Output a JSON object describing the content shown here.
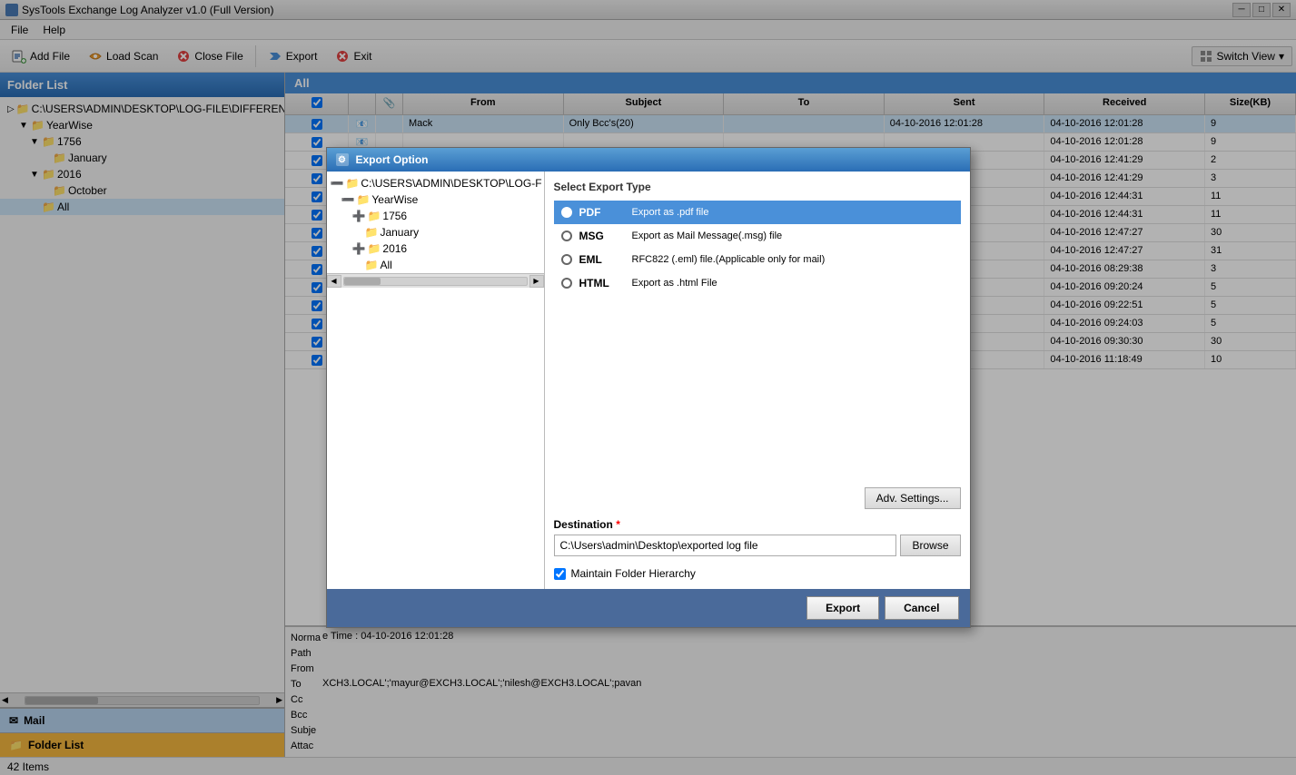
{
  "app": {
    "title": "SysTools Exchange Log Analyzer v1.0 (Full Version)"
  },
  "menu": {
    "items": [
      "File",
      "Help"
    ]
  },
  "toolbar": {
    "buttons": [
      {
        "id": "add-file",
        "label": "Add File",
        "icon": "➕"
      },
      {
        "id": "load-scan",
        "label": "Load Scan",
        "icon": "📂"
      },
      {
        "id": "close-file",
        "label": "Close File",
        "icon": "✖"
      },
      {
        "id": "export",
        "label": "Export",
        "icon": "▶"
      },
      {
        "id": "exit",
        "label": "Exit",
        "icon": "✖"
      }
    ],
    "switch_view": "Switch View"
  },
  "folder_list": {
    "header": "Folder List",
    "tree": [
      {
        "id": "root",
        "label": "C:\\USERS\\ADMIN\\DESKTOP\\LOG-FILE\\DIFFERENTT",
        "indent": 0,
        "icon": "folder",
        "expanded": true
      },
      {
        "id": "yearwise",
        "label": "YearWise",
        "indent": 1,
        "icon": "folder",
        "expanded": true
      },
      {
        "id": "1756",
        "label": "1756",
        "indent": 2,
        "icon": "folder",
        "expanded": true
      },
      {
        "id": "january",
        "label": "January",
        "indent": 3,
        "icon": "folder",
        "expanded": false
      },
      {
        "id": "2016",
        "label": "2016",
        "indent": 2,
        "icon": "folder",
        "expanded": true
      },
      {
        "id": "october",
        "label": "October",
        "indent": 3,
        "icon": "folder",
        "expanded": false
      },
      {
        "id": "all",
        "label": "All",
        "indent": 2,
        "icon": "folder",
        "expanded": false,
        "selected": true
      }
    ],
    "bottom_tabs": [
      {
        "id": "mail",
        "label": "Mail"
      },
      {
        "id": "folder-list",
        "label": "Folder List"
      }
    ]
  },
  "main_panel": {
    "header": "All",
    "columns": [
      "",
      "",
      "",
      "From",
      "Subject",
      "To",
      "Sent",
      "Received",
      "Size(KB)"
    ],
    "rows": [
      {
        "checked": true,
        "from": "Mack",
        "subject": "Only Bcc's(20)",
        "to": "",
        "sent": "04-10-2016 12:01:28",
        "received": "04-10-2016 12:01:28",
        "size": "9",
        "selected": true
      },
      {
        "checked": true,
        "from": "",
        "subject": "",
        "to": "",
        "sent": "",
        "received": "04-10-2016 12:01:28",
        "size": "9"
      },
      {
        "checked": true,
        "from": "",
        "subject": "",
        "to": "",
        "sent": "",
        "received": "04-10-2016 12:41:29",
        "size": "2"
      },
      {
        "checked": true,
        "from": "",
        "subject": "",
        "to": "",
        "sent": "",
        "received": "04-10-2016 12:41:29",
        "size": "3"
      },
      {
        "checked": true,
        "from": "",
        "subject": "",
        "to": "",
        "sent": "",
        "received": "04-10-2016 12:44:31",
        "size": "11"
      },
      {
        "checked": true,
        "from": "",
        "subject": "",
        "to": "",
        "sent": "",
        "received": "04-10-2016 12:44:31",
        "size": "11"
      },
      {
        "checked": true,
        "from": "",
        "subject": "",
        "to": "",
        "sent": "",
        "received": "04-10-2016 12:47:27",
        "size": "30"
      },
      {
        "checked": true,
        "from": "",
        "subject": "",
        "to": "",
        "sent": "",
        "received": "04-10-2016 12:47:27",
        "size": "31"
      },
      {
        "checked": true,
        "from": "",
        "subject": "",
        "to": "",
        "sent": "",
        "received": "04-10-2016 08:29:38",
        "size": "3"
      },
      {
        "checked": true,
        "from": "",
        "subject": "",
        "to": "",
        "sent": "",
        "received": "04-10-2016 09:20:24",
        "size": "5"
      },
      {
        "checked": true,
        "from": "",
        "subject": "",
        "to": "",
        "sent": "",
        "received": "04-10-2016 09:22:51",
        "size": "5"
      },
      {
        "checked": true,
        "from": "",
        "subject": "",
        "to": "",
        "sent": "",
        "received": "04-10-2016 09:24:03",
        "size": "5"
      },
      {
        "checked": true,
        "from": "",
        "subject": "",
        "to": "",
        "sent": "",
        "received": "04-10-2016 09:30:30",
        "size": "30"
      },
      {
        "checked": true,
        "from": "",
        "subject": "",
        "to": "",
        "sent": "",
        "received": "04-10-2016 11:18:49",
        "size": "10"
      }
    ]
  },
  "detail_panel": {
    "norma_label": "Norma",
    "path_label": "Path",
    "from_label": "From",
    "to_label": "To",
    "cc_label": "Cc",
    "bcc_label": "Bcc",
    "subject_label": "Subje",
    "attach_label": "Attac",
    "time_label": "e Time  :  04-10-2016 12:01:28",
    "bcc_value": "XCH3.LOCAL';'mayur@EXCH3.LOCAL';'nilesh@EXCH3.LOCAL';pavan"
  },
  "status_bar": {
    "text": "42 Items"
  },
  "export_dialog": {
    "title": "Export Option",
    "select_export_type_label": "Select Export Type",
    "export_types": [
      {
        "id": "pdf",
        "name": "PDF",
        "desc": "Export as .pdf file",
        "selected": true
      },
      {
        "id": "msg",
        "name": "MSG",
        "desc": "Export as Mail Message(.msg) file",
        "selected": false
      },
      {
        "id": "eml",
        "name": "EML",
        "desc": "RFC822 (.eml) file.(Applicable only for mail)",
        "selected": false
      },
      {
        "id": "html",
        "name": "HTML",
        "desc": "Export as .html File",
        "selected": false
      }
    ],
    "adv_settings_label": "Adv. Settings...",
    "destination_label": "Destination",
    "destination_required": "*",
    "destination_value": "C:\\Users\\admin\\Desktop\\exported log file",
    "browse_label": "Browse",
    "maintain_folder": "Maintain Folder Hierarchy",
    "maintain_checked": true,
    "export_btn": "Export",
    "cancel_btn": "Cancel",
    "folder_tree": [
      {
        "label": "C:\\USERS\\ADMIN\\DESKTOP\\LOG-F",
        "indent": 0
      },
      {
        "label": "YearWise",
        "indent": 1
      },
      {
        "label": "1756",
        "indent": 2
      },
      {
        "label": "January",
        "indent": 3
      },
      {
        "label": "2016",
        "indent": 2
      },
      {
        "label": "All",
        "indent": 3
      }
    ]
  }
}
